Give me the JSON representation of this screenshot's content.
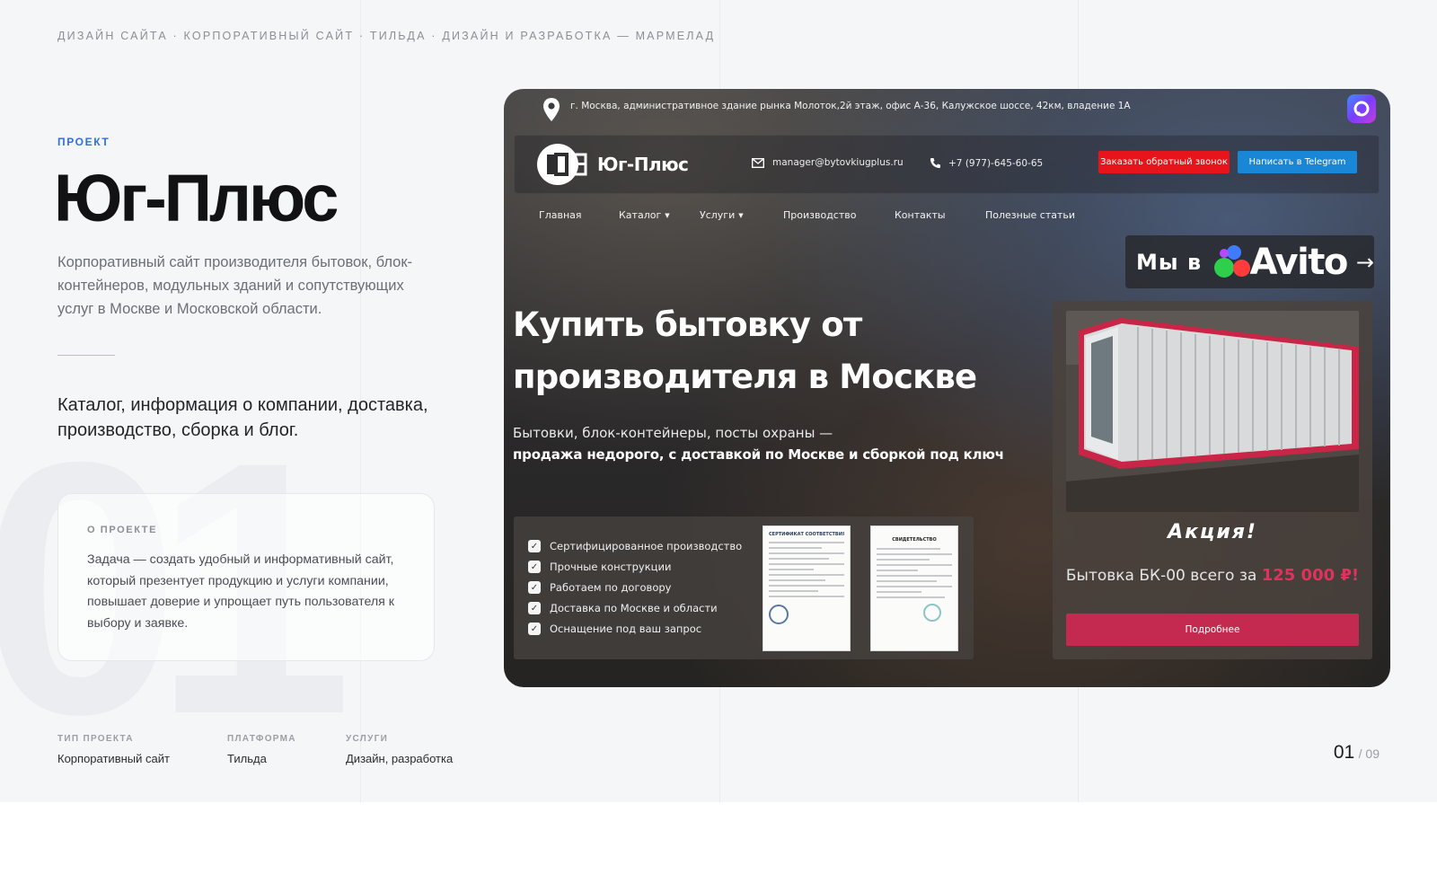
{
  "breadcrumb": "ДИЗАЙН САЙТА · КОРПОРАТИВНЫЙ САЙТ · ТИЛЬДА · ДИЗАЙН И РАЗРАБОТКА — МАРМЕЛАД",
  "project_label": "ПРОЕКТ",
  "title": "Юг-Плюс",
  "description": "Корпоративный сайт производителя бытовок, блок-контейнеров, модульных зданий и сопутствующих услуг в Москве и Московской области.",
  "subtitle": "Каталог, информация о компании, доставка, производство, сборка и блог.",
  "background_number": "01",
  "about": {
    "label": "О ПРОЕКТЕ",
    "text": "Задача — создать удобный и информативный сайт, который презентует продукцию и услуги компании, повышает доверие и упрощает путь пользователя к выбору и заявке."
  },
  "meta": [
    {
      "label": "ТИП ПРОЕКТА",
      "value": "Корпоративный сайт"
    },
    {
      "label": "ПЛАТФОРМА",
      "value": "Тильда"
    },
    {
      "label": "УСЛУГИ",
      "value": "Дизайн, разработка"
    }
  ],
  "pager": {
    "current": "01",
    "total": "/ 09"
  },
  "screenshot": {
    "address": "г. Москва, административное здание рынка Молоток,2й этаж, офис А-36, Калужское шоссе, 42км, владение 1А",
    "logo_text": "Юг-Плюс",
    "email": "manager@bytovkiugplus.ru",
    "phone": "+7 (977)-645-60-65",
    "btn_callback": "Заказать обратный звонок",
    "btn_telegram": "Написать в Telegram",
    "nav": [
      "Главная",
      "Каталог",
      "Услуги",
      "Производство",
      "Контакты",
      "Полезные статьи"
    ],
    "avito_prefix": "Мы в",
    "avito_brand": "Avito",
    "avito_arrow": "→",
    "hero_title": "Купить бытовку от производителя в Москве",
    "hero_sub1": "Бытовки, блок-контейнеры, посты охраны —",
    "hero_sub2": "продажа недорого, с доставкой по Москве и сборкой под ключ",
    "features": [
      "Сертифицированное производство",
      "Прочные конструкции",
      "Работаем по договору",
      "Доставка по Москве и области",
      "Оснащение под ваш запрос"
    ],
    "cert1_title": "СЕРТИФИКАТ СООТВЕТСТВИЯ",
    "cert2_title": "СВИДЕТЕЛЬСТВО",
    "promo_title": "Акция!",
    "promo_price_text": "Бытовка БК-00 всего за",
    "promo_price_value": "125 000 ₽!",
    "promo_button": "Подробнее",
    "colors": {
      "callback": "#e7141c",
      "telegram": "#1a86d6",
      "promo_accent": "#c42a4f"
    }
  },
  "colors": {
    "accent": "#2f6fe0",
    "background": "#f5f6f8"
  }
}
